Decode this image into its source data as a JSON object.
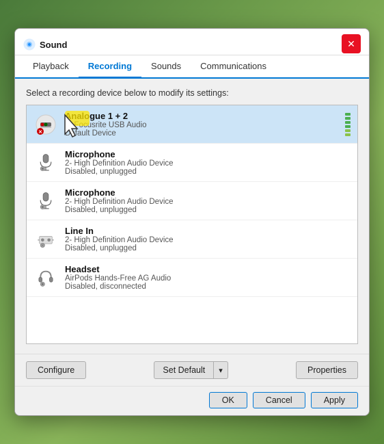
{
  "window": {
    "title": "Sound",
    "close_label": "✕"
  },
  "tabs": [
    {
      "id": "playback",
      "label": "Playback",
      "active": false
    },
    {
      "id": "recording",
      "label": "Recording",
      "active": true
    },
    {
      "id": "sounds",
      "label": "Sounds",
      "active": false
    },
    {
      "id": "communications",
      "label": "Communications",
      "active": false
    }
  ],
  "instruction": "Select a recording device below to modify its settings:",
  "devices": [
    {
      "id": "analogue",
      "name": "Analogue 1 + 2",
      "sub": "2- Focusrite USB Audio",
      "status": "Default Device",
      "selected": true,
      "icon_type": "analogue",
      "show_level": true
    },
    {
      "id": "mic1",
      "name": "Microphone",
      "sub": "2- High Definition Audio Device",
      "status": "Disabled, unplugged",
      "selected": false,
      "icon_type": "mic",
      "show_level": false
    },
    {
      "id": "mic2",
      "name": "Microphone",
      "sub": "2- High Definition Audio Device",
      "status": "Disabled, unplugged",
      "selected": false,
      "icon_type": "mic",
      "show_level": false
    },
    {
      "id": "linein",
      "name": "Line In",
      "sub": "2- High Definition Audio Device",
      "status": "Disabled, unplugged",
      "selected": false,
      "icon_type": "linein",
      "show_level": false
    },
    {
      "id": "headset",
      "name": "Headset",
      "sub": "AirPods Hands-Free AG Audio",
      "status": "Disabled, disconnected",
      "selected": false,
      "icon_type": "headset",
      "show_level": false
    }
  ],
  "buttons": {
    "configure": "Configure",
    "set_default": "Set Default",
    "dropdown_arrow": "▾",
    "properties": "Properties",
    "ok": "OK",
    "cancel": "Cancel",
    "apply": "Apply"
  }
}
